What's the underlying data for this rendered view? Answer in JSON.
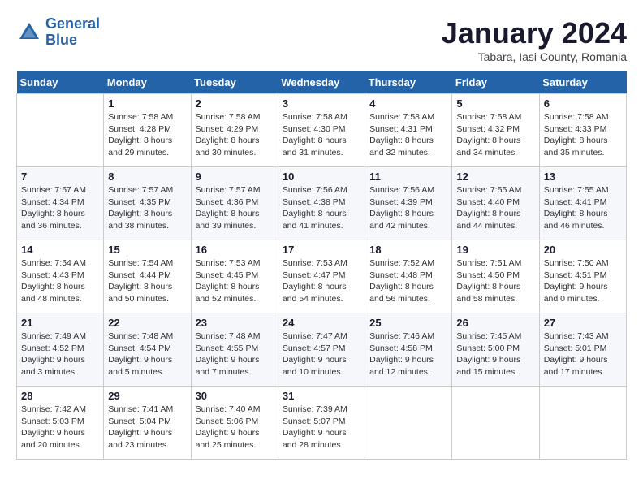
{
  "logo": {
    "line1": "General",
    "line2": "Blue"
  },
  "header": {
    "month": "January 2024",
    "location": "Tabara, Iasi County, Romania"
  },
  "weekdays": [
    "Sunday",
    "Monday",
    "Tuesday",
    "Wednesday",
    "Thursday",
    "Friday",
    "Saturday"
  ],
  "weeks": [
    [
      {
        "day": "",
        "sunrise": "",
        "sunset": "",
        "daylight": ""
      },
      {
        "day": "1",
        "sunrise": "Sunrise: 7:58 AM",
        "sunset": "Sunset: 4:28 PM",
        "daylight": "Daylight: 8 hours and 29 minutes."
      },
      {
        "day": "2",
        "sunrise": "Sunrise: 7:58 AM",
        "sunset": "Sunset: 4:29 PM",
        "daylight": "Daylight: 8 hours and 30 minutes."
      },
      {
        "day": "3",
        "sunrise": "Sunrise: 7:58 AM",
        "sunset": "Sunset: 4:30 PM",
        "daylight": "Daylight: 8 hours and 31 minutes."
      },
      {
        "day": "4",
        "sunrise": "Sunrise: 7:58 AM",
        "sunset": "Sunset: 4:31 PM",
        "daylight": "Daylight: 8 hours and 32 minutes."
      },
      {
        "day": "5",
        "sunrise": "Sunrise: 7:58 AM",
        "sunset": "Sunset: 4:32 PM",
        "daylight": "Daylight: 8 hours and 34 minutes."
      },
      {
        "day": "6",
        "sunrise": "Sunrise: 7:58 AM",
        "sunset": "Sunset: 4:33 PM",
        "daylight": "Daylight: 8 hours and 35 minutes."
      }
    ],
    [
      {
        "day": "7",
        "sunrise": "Sunrise: 7:57 AM",
        "sunset": "Sunset: 4:34 PM",
        "daylight": "Daylight: 8 hours and 36 minutes."
      },
      {
        "day": "8",
        "sunrise": "Sunrise: 7:57 AM",
        "sunset": "Sunset: 4:35 PM",
        "daylight": "Daylight: 8 hours and 38 minutes."
      },
      {
        "day": "9",
        "sunrise": "Sunrise: 7:57 AM",
        "sunset": "Sunset: 4:36 PM",
        "daylight": "Daylight: 8 hours and 39 minutes."
      },
      {
        "day": "10",
        "sunrise": "Sunrise: 7:56 AM",
        "sunset": "Sunset: 4:38 PM",
        "daylight": "Daylight: 8 hours and 41 minutes."
      },
      {
        "day": "11",
        "sunrise": "Sunrise: 7:56 AM",
        "sunset": "Sunset: 4:39 PM",
        "daylight": "Daylight: 8 hours and 42 minutes."
      },
      {
        "day": "12",
        "sunrise": "Sunrise: 7:55 AM",
        "sunset": "Sunset: 4:40 PM",
        "daylight": "Daylight: 8 hours and 44 minutes."
      },
      {
        "day": "13",
        "sunrise": "Sunrise: 7:55 AM",
        "sunset": "Sunset: 4:41 PM",
        "daylight": "Daylight: 8 hours and 46 minutes."
      }
    ],
    [
      {
        "day": "14",
        "sunrise": "Sunrise: 7:54 AM",
        "sunset": "Sunset: 4:43 PM",
        "daylight": "Daylight: 8 hours and 48 minutes."
      },
      {
        "day": "15",
        "sunrise": "Sunrise: 7:54 AM",
        "sunset": "Sunset: 4:44 PM",
        "daylight": "Daylight: 8 hours and 50 minutes."
      },
      {
        "day": "16",
        "sunrise": "Sunrise: 7:53 AM",
        "sunset": "Sunset: 4:45 PM",
        "daylight": "Daylight: 8 hours and 52 minutes."
      },
      {
        "day": "17",
        "sunrise": "Sunrise: 7:53 AM",
        "sunset": "Sunset: 4:47 PM",
        "daylight": "Daylight: 8 hours and 54 minutes."
      },
      {
        "day": "18",
        "sunrise": "Sunrise: 7:52 AM",
        "sunset": "Sunset: 4:48 PM",
        "daylight": "Daylight: 8 hours and 56 minutes."
      },
      {
        "day": "19",
        "sunrise": "Sunrise: 7:51 AM",
        "sunset": "Sunset: 4:50 PM",
        "daylight": "Daylight: 8 hours and 58 minutes."
      },
      {
        "day": "20",
        "sunrise": "Sunrise: 7:50 AM",
        "sunset": "Sunset: 4:51 PM",
        "daylight": "Daylight: 9 hours and 0 minutes."
      }
    ],
    [
      {
        "day": "21",
        "sunrise": "Sunrise: 7:49 AM",
        "sunset": "Sunset: 4:52 PM",
        "daylight": "Daylight: 9 hours and 3 minutes."
      },
      {
        "day": "22",
        "sunrise": "Sunrise: 7:48 AM",
        "sunset": "Sunset: 4:54 PM",
        "daylight": "Daylight: 9 hours and 5 minutes."
      },
      {
        "day": "23",
        "sunrise": "Sunrise: 7:48 AM",
        "sunset": "Sunset: 4:55 PM",
        "daylight": "Daylight: 9 hours and 7 minutes."
      },
      {
        "day": "24",
        "sunrise": "Sunrise: 7:47 AM",
        "sunset": "Sunset: 4:57 PM",
        "daylight": "Daylight: 9 hours and 10 minutes."
      },
      {
        "day": "25",
        "sunrise": "Sunrise: 7:46 AM",
        "sunset": "Sunset: 4:58 PM",
        "daylight": "Daylight: 9 hours and 12 minutes."
      },
      {
        "day": "26",
        "sunrise": "Sunrise: 7:45 AM",
        "sunset": "Sunset: 5:00 PM",
        "daylight": "Daylight: 9 hours and 15 minutes."
      },
      {
        "day": "27",
        "sunrise": "Sunrise: 7:43 AM",
        "sunset": "Sunset: 5:01 PM",
        "daylight": "Daylight: 9 hours and 17 minutes."
      }
    ],
    [
      {
        "day": "28",
        "sunrise": "Sunrise: 7:42 AM",
        "sunset": "Sunset: 5:03 PM",
        "daylight": "Daylight: 9 hours and 20 minutes."
      },
      {
        "day": "29",
        "sunrise": "Sunrise: 7:41 AM",
        "sunset": "Sunset: 5:04 PM",
        "daylight": "Daylight: 9 hours and 23 minutes."
      },
      {
        "day": "30",
        "sunrise": "Sunrise: 7:40 AM",
        "sunset": "Sunset: 5:06 PM",
        "daylight": "Daylight: 9 hours and 25 minutes."
      },
      {
        "day": "31",
        "sunrise": "Sunrise: 7:39 AM",
        "sunset": "Sunset: 5:07 PM",
        "daylight": "Daylight: 9 hours and 28 minutes."
      },
      {
        "day": "",
        "sunrise": "",
        "sunset": "",
        "daylight": ""
      },
      {
        "day": "",
        "sunrise": "",
        "sunset": "",
        "daylight": ""
      },
      {
        "day": "",
        "sunrise": "",
        "sunset": "",
        "daylight": ""
      }
    ]
  ]
}
